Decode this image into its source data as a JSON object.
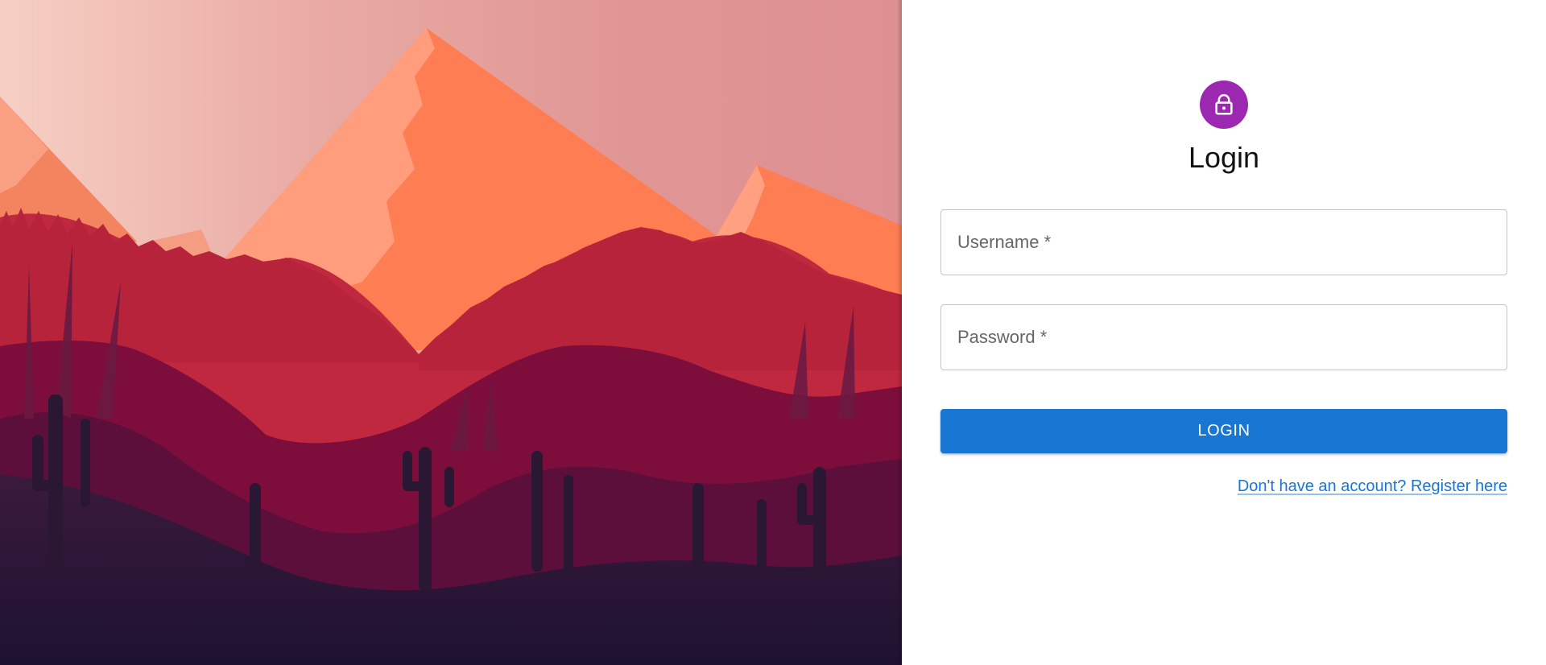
{
  "login": {
    "title": "Login",
    "username_placeholder": "Username *",
    "password_placeholder": "Password *",
    "button_label": "LOGIN",
    "register_link": "Don't have an account? Register here",
    "avatar_icon": "lock-icon"
  },
  "colors": {
    "avatar": "#9c27b0",
    "primary": "#1976d2",
    "sky": "#e19494",
    "mountain": "#ff7f50",
    "foreground": "#7e0e3a",
    "ground": "#221531"
  }
}
